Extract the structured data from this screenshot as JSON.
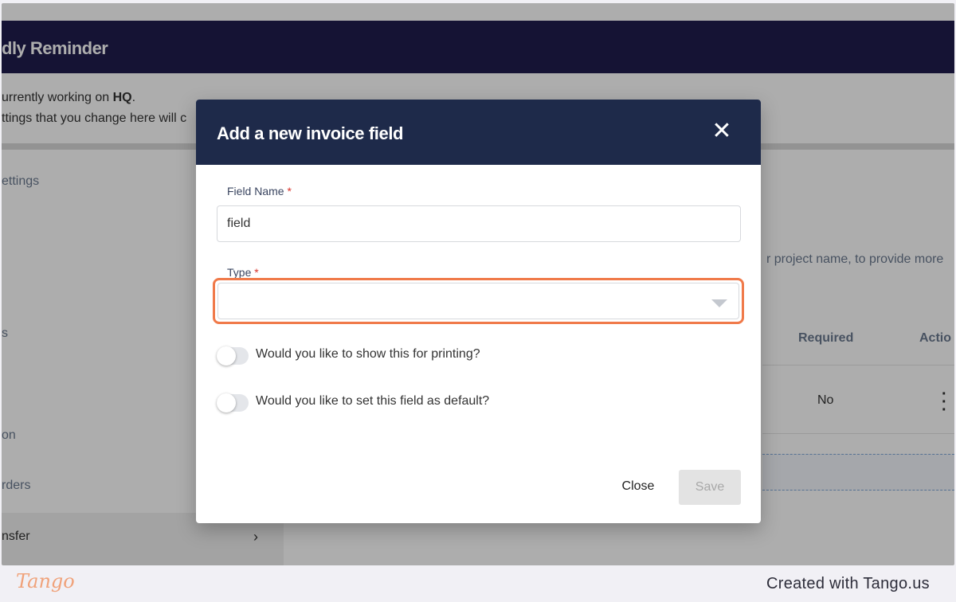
{
  "app": {
    "title": "dly Reminder",
    "notice_prefix": "urrently working on ",
    "notice_bold": "HQ",
    "notice_suffix": ".",
    "notice_line2": "ttings that you change here will c"
  },
  "sidebar": {
    "items": [
      {
        "label": "ettings"
      },
      {
        "label": "s"
      },
      {
        "label": "on"
      },
      {
        "label": "rders"
      },
      {
        "label": "nsfer"
      }
    ]
  },
  "content": {
    "description": "r project name, to provide more",
    "table": {
      "headers": [
        "Required",
        "Actio"
      ],
      "rows": [
        {
          "required": "No"
        }
      ]
    }
  },
  "modal": {
    "title": "Add a new invoice field",
    "close_icon": "close-icon",
    "field_name_label": "Field Name",
    "field_name_value": "field",
    "type_label": "Type",
    "required_marker": "*",
    "type_value": "",
    "toggle_print_label": "Would you like to show this for printing?",
    "toggle_default_label": "Would you like to set this field as default?",
    "toggle_print_on": false,
    "toggle_default_on": false,
    "close_button": "Close",
    "save_button": "Save"
  },
  "footer": {
    "logo": "Tango",
    "credit": "Created with Tango.us"
  },
  "colors": {
    "header_bg": "#1f1d4d",
    "modal_header_bg": "#1e2a4a",
    "highlight": "#f07a4a",
    "required": "#d9342b"
  }
}
